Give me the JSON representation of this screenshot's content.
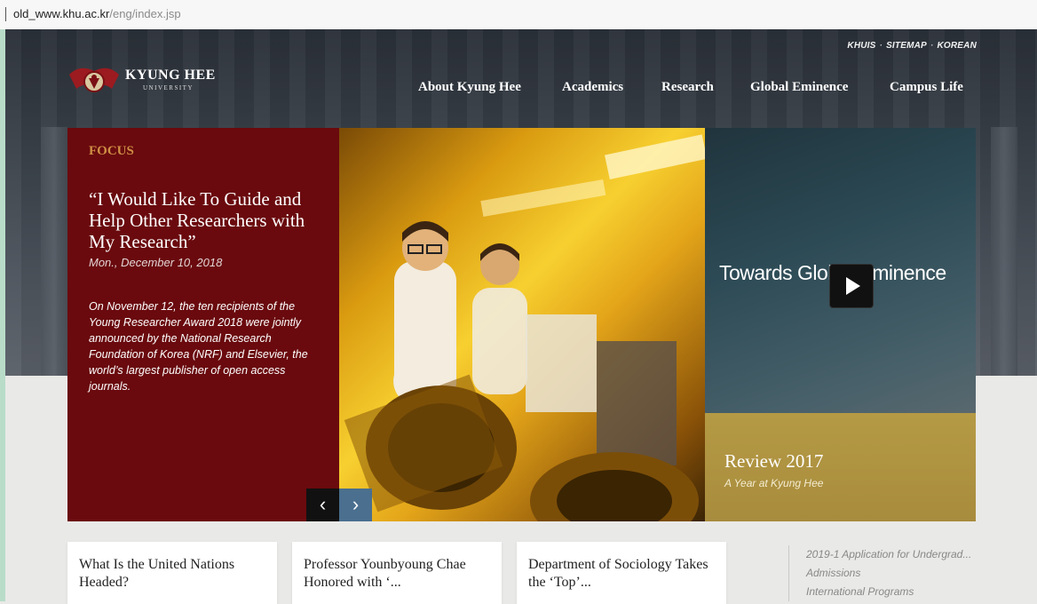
{
  "browser": {
    "url_host": "old_www.khu.ac.kr",
    "url_path": "/eng/index.jsp"
  },
  "header": {
    "top_links": [
      "KHUIS",
      "SITEMAP",
      "KOREAN"
    ],
    "logo_name": "KYUNG HEE",
    "logo_sub": "UNIVERSITY",
    "nav": [
      "About Kyung Hee",
      "Academics",
      "Research",
      "Global Eminence",
      "Campus Life"
    ]
  },
  "focus": {
    "kicker": "FOCUS",
    "title": "“I Would Like To Guide and Help Other Researchers with My Research”",
    "date": "Mon., December 10, 2018",
    "body": "On November 12, the ten recipients of the Young Researcher Award 2018 were jointly announced by the National Research Foundation of Korea (NRF) and Elsevier, the world’s largest publisher of open access journals."
  },
  "carousel": {
    "prev_icon": "chevron-left-icon",
    "next_icon": "chevron-right-icon"
  },
  "video": {
    "title": "Towards Global Eminence",
    "play_icon": "play-icon"
  },
  "review": {
    "title": "Review 2017",
    "subtitle": "A Year at Kyung Hee"
  },
  "news": [
    {
      "title": "What Is the United Nations Headed?"
    },
    {
      "title": "Professor Younbyoung Chae Honored with ‘..."
    },
    {
      "title": "Department of Sociology Takes the ‘Top’..."
    }
  ],
  "quick_links": [
    "2019-1 Application for Undergrad...",
    "Admissions",
    "International Programs"
  ],
  "colors": {
    "focus_bg": "#6a0a0e",
    "kicker": "#cf8f45",
    "review_bg": "#b59a45",
    "next_btn": "#4a6f8f"
  }
}
